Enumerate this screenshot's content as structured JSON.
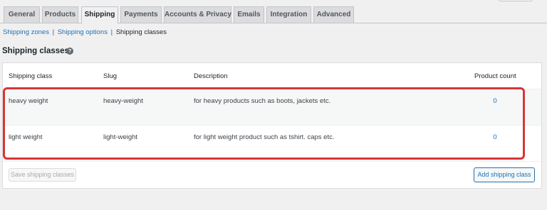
{
  "tabs": [
    "General",
    "Products",
    "Shipping",
    "Payments",
    "Accounts & Privacy",
    "Emails",
    "Integration",
    "Advanced"
  ],
  "active_tab": "Shipping",
  "subnav": {
    "zones": "Shipping zones",
    "options": "Shipping options",
    "classes": "Shipping classes",
    "separator": "|"
  },
  "section": {
    "title": "Shipping classes",
    "help_glyph": "?"
  },
  "table": {
    "headers": {
      "class": "Shipping class",
      "slug": "Slug",
      "description": "Description",
      "count": "Product count"
    },
    "rows": [
      {
        "class": "heavy weight",
        "slug": "heavy-weight",
        "description": "for heavy products such as boots, jackets etc.",
        "count": "0"
      },
      {
        "class": "light weight",
        "slug": "light-weight",
        "description": "for light weight product such as tshirt. caps etc.",
        "count": "0"
      }
    ]
  },
  "buttons": {
    "save": "Save shipping classes",
    "add": "Add shipping class"
  },
  "colors": {
    "highlight": "#d63638",
    "link": "#2271b1"
  }
}
